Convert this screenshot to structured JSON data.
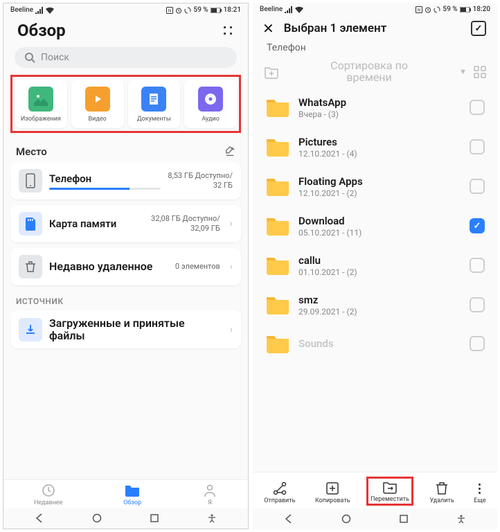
{
  "status": {
    "carrier": "Beeline",
    "left_icons": [
      "signal",
      "wifi",
      "extra"
    ],
    "right_icons": [
      "nfc",
      "alarm",
      "sync"
    ],
    "batt_left": "59 %",
    "batt_right": "59 %",
    "time_left": "18:21",
    "time_right": "18:20"
  },
  "left": {
    "title": "Обзор",
    "search_placeholder": "Поиск",
    "categories": [
      {
        "label": "Изображения",
        "icon": "image"
      },
      {
        "label": "Видео",
        "icon": "video"
      },
      {
        "label": "Документы",
        "icon": "document"
      },
      {
        "label": "Аудио",
        "icon": "audio"
      }
    ],
    "place_header": "Место",
    "storage": [
      {
        "name": "Телефон",
        "meta1": "8,53 ГБ Доступно/",
        "meta2": "32 ГБ",
        "icon": "phone",
        "bar": true
      },
      {
        "name": "Карта памяти",
        "meta1": "32,08 ГБ Доступно/",
        "meta2": "32,09 ГБ",
        "icon": "sd",
        "bar": false
      },
      {
        "name": "Недавно удаленное",
        "meta1": "0 элементов",
        "meta2": "",
        "icon": "trash",
        "bar": false
      }
    ],
    "source_header": "ИСТОЧНИК",
    "downloads": {
      "name": "Загруженные и принятые файлы"
    },
    "tabs": [
      {
        "label": "Недавнее",
        "icon": "clock",
        "active": false
      },
      {
        "label": "Обзор",
        "icon": "folder",
        "active": true
      },
      {
        "label": "Я",
        "icon": "person",
        "active": false
      }
    ]
  },
  "right": {
    "header_title": "Выбран 1 элемент",
    "crumb": "Телефон",
    "sort_top": "Сортировка по",
    "sort_bot": "времени",
    "folders": [
      {
        "name": "WhatsApp",
        "meta": "Вчера - (3)",
        "checked": false
      },
      {
        "name": "Pictures",
        "meta": "12.10.2021 - (4)",
        "checked": false
      },
      {
        "name": "Floating Apps",
        "meta": "12.10.2021 - (2)",
        "checked": false
      },
      {
        "name": "Download",
        "meta": "05.10.2021 - (11)",
        "checked": true
      },
      {
        "name": "callu",
        "meta": "01.10.2021 - (2)",
        "checked": false
      },
      {
        "name": "smz",
        "meta": "29.09.2021 - (2)",
        "checked": false
      },
      {
        "name": "Sounds",
        "meta": "",
        "checked": false,
        "cut": true
      }
    ],
    "actions": [
      {
        "label": "Отправить",
        "icon": "share"
      },
      {
        "label": "Копировать",
        "icon": "copy"
      },
      {
        "label": "Переместить",
        "icon": "move",
        "highlight": true
      },
      {
        "label": "Удалить",
        "icon": "delete"
      },
      {
        "label": "Еще",
        "icon": "more"
      }
    ]
  }
}
